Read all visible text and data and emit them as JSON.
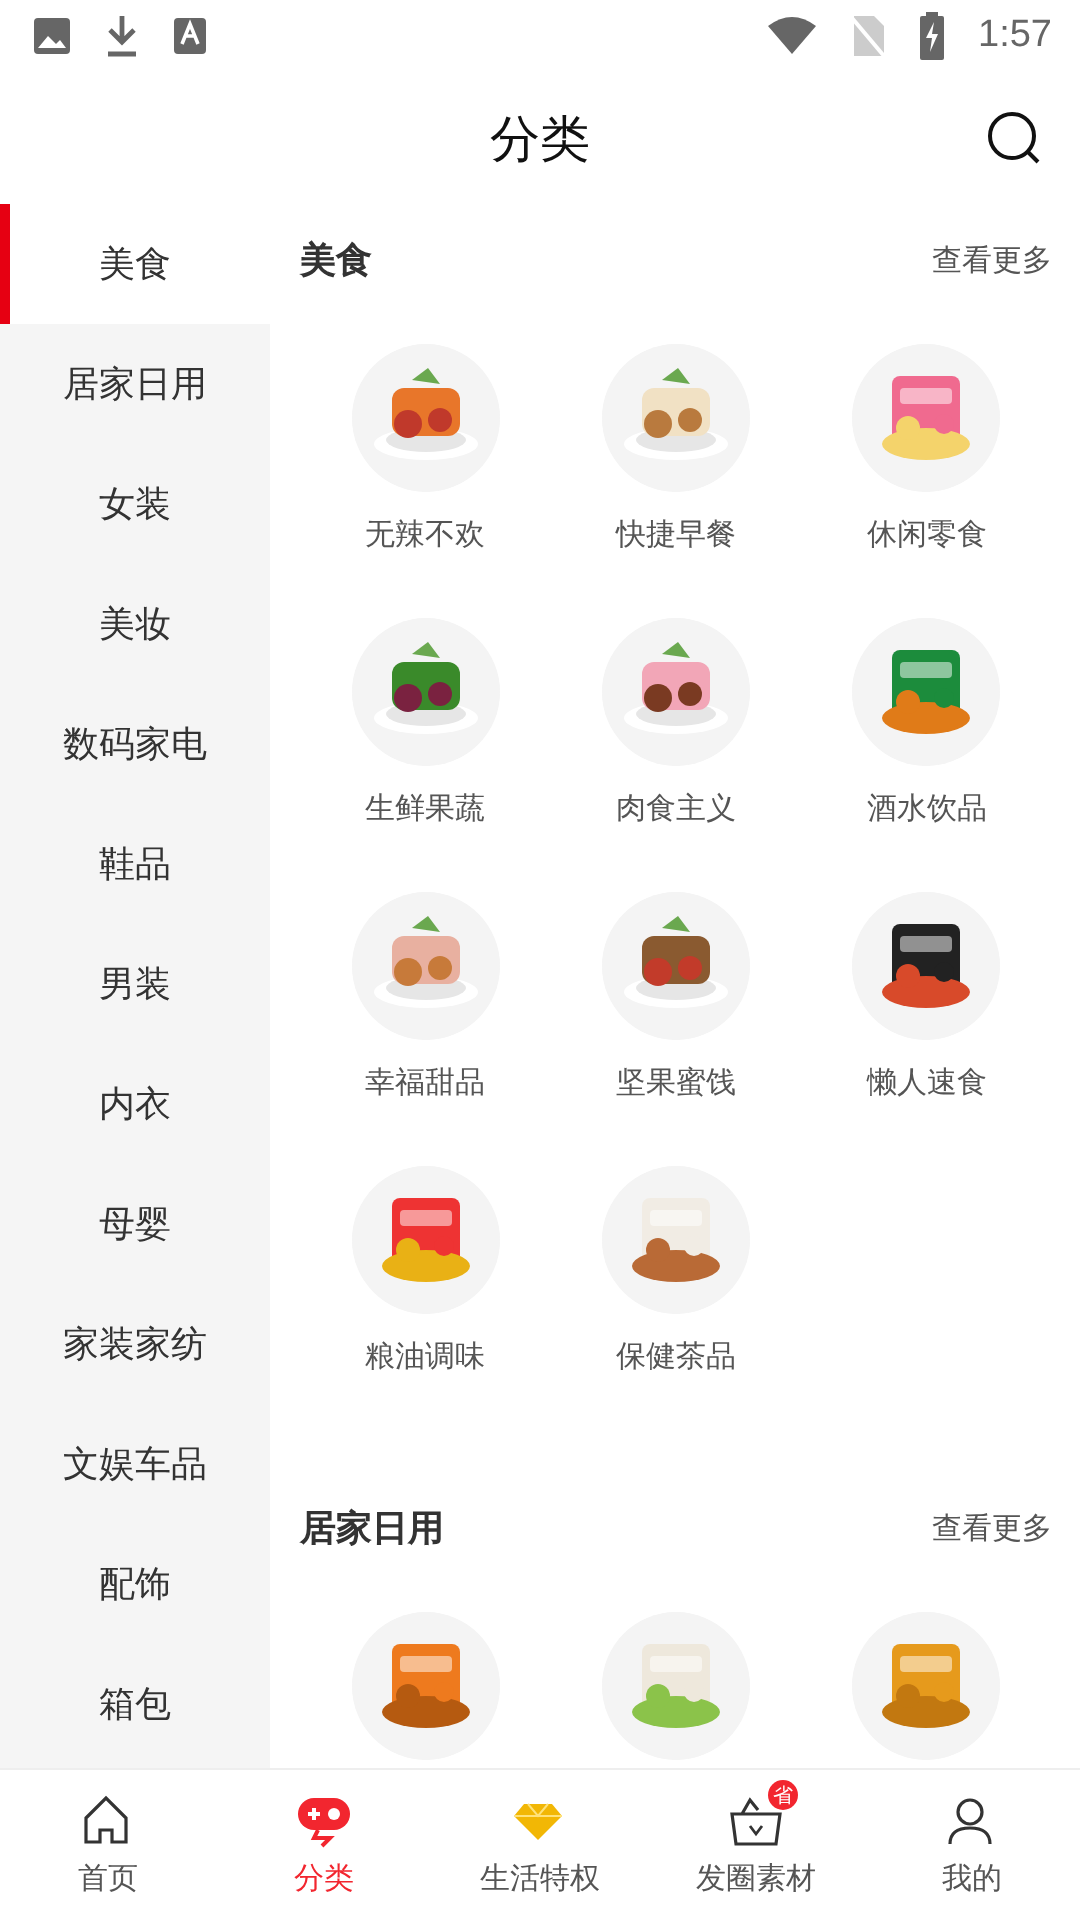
{
  "status_bar": {
    "time": "1:57"
  },
  "header": {
    "title": "分类"
  },
  "sidebar": {
    "items": [
      {
        "label": "美食",
        "selected": true
      },
      {
        "label": "居家日用",
        "selected": false
      },
      {
        "label": "女装",
        "selected": false
      },
      {
        "label": "美妆",
        "selected": false
      },
      {
        "label": "数码家电",
        "selected": false
      },
      {
        "label": "鞋品",
        "selected": false
      },
      {
        "label": "男装",
        "selected": false
      },
      {
        "label": "内衣",
        "selected": false
      },
      {
        "label": "母婴",
        "selected": false
      },
      {
        "label": "家装家纺",
        "selected": false
      },
      {
        "label": "文娱车品",
        "selected": false
      },
      {
        "label": "配饰",
        "selected": false
      },
      {
        "label": "箱包",
        "selected": false
      }
    ]
  },
  "sections": [
    {
      "title": "美食",
      "more": "查看更多",
      "items": [
        {
          "label": "无辣不欢"
        },
        {
          "label": "快捷早餐"
        },
        {
          "label": "休闲零食"
        },
        {
          "label": "生鲜果蔬"
        },
        {
          "label": "肉食主义"
        },
        {
          "label": "酒水饮品"
        },
        {
          "label": "幸福甜品"
        },
        {
          "label": "坚果蜜饯"
        },
        {
          "label": "懒人速食"
        },
        {
          "label": "粮油调味"
        },
        {
          "label": "保健茶品"
        }
      ]
    },
    {
      "title": "居家日用",
      "more": "查看更多"
    }
  ],
  "tab_bar": {
    "items": [
      {
        "label": "首页",
        "selected": false
      },
      {
        "label": "分类",
        "selected": true
      },
      {
        "label": "生活特权",
        "selected": false
      },
      {
        "label": "发圈素材",
        "selected": false,
        "badge": "省"
      },
      {
        "label": "我的",
        "selected": false
      }
    ]
  }
}
